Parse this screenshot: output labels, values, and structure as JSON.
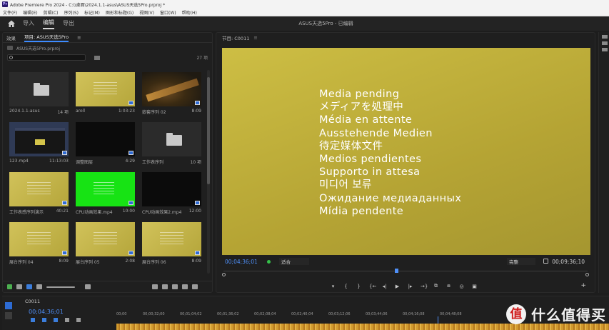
{
  "window": {
    "title": "Adobe Premiere Pro 2024 - C:\\\\桌面\\2024.1.1-asus\\ASUS天选5Pro.prproj *",
    "app_icon_text": "Pr"
  },
  "menubar": [
    "文件(F)",
    "编辑(E)",
    "剪辑(C)",
    "序列(S)",
    "标记(M)",
    "图形和标题(G)",
    "视图(V)",
    "窗口(W)",
    "帮助(H)"
  ],
  "workspace": {
    "tabs": [
      "导入",
      "编辑",
      "导出"
    ],
    "active_tab": "编辑",
    "project_name": "ASUS天选5Pro - 已编辑"
  },
  "project": {
    "tabs": [
      "效果",
      "项目: ASUS天选5Pro",
      "≡"
    ],
    "path": "ASUS天选5Pro.prproj",
    "search_placeholder": "",
    "item_count": "27 项",
    "items": [
      {
        "name": "2024.1.1-asus",
        "meta": "14 项",
        "kind": "folder"
      },
      {
        "name": "aroll",
        "meta": "1:03:23",
        "kind": "gold"
      },
      {
        "name": "嵌套序列 02",
        "meta": "8:09",
        "kind": "wood"
      },
      {
        "name": "123.mp4",
        "meta": "11:13:03",
        "kind": "screen"
      },
      {
        "name": "调整图层",
        "meta": "4:29",
        "kind": "black"
      },
      {
        "name": "工作表序列",
        "meta": "10 项",
        "kind": "folder"
      },
      {
        "name": "工作表感序列演示",
        "meta": "40:21",
        "kind": "gold"
      },
      {
        "name": "CPU动画效果.mp4",
        "meta": "10:00",
        "kind": "green"
      },
      {
        "name": "CPU动画效果2.mp4",
        "meta": "12:00",
        "kind": "black"
      },
      {
        "name": "展台序列 04",
        "meta": "8:09",
        "kind": "gold"
      },
      {
        "name": "展台序列 05",
        "meta": "2:08",
        "kind": "gold"
      },
      {
        "name": "展台序列 06",
        "meta": "8:09",
        "kind": "gold"
      }
    ]
  },
  "program": {
    "title": "节目: C0011",
    "menu_icon": "≡",
    "media_pending": [
      "Media pending",
      "メディアを処理中",
      "Média en attente",
      "Ausstehende Medien",
      "待定媒体文件",
      "Medios pendientes",
      "Supporto in attesa",
      "미디어 보류",
      "Ожидание медиаданных",
      "Mídia pendente"
    ],
    "current_tc": "00;04;36;01",
    "duration_tc": "00;09;36;10",
    "fit_label": "适合",
    "quality_label": "完整",
    "controls": [
      "▾",
      "{",
      "}",
      "{←",
      "◂|",
      "▶",
      "|▸",
      "→}",
      "⧉",
      "⧈",
      "◎",
      "▣"
    ],
    "add_button": "+"
  },
  "timeline": {
    "sequence": "C0011",
    "current_tc": "00;04;36;01",
    "ticks": [
      "00;00",
      "00;00;32;00",
      "00;01;04;02",
      "00;01;36;02",
      "00;02;08;04",
      "00;02;40;04",
      "00;03;12;06",
      "00;03;44;06",
      "00;04;16;08",
      "00;04;48;08"
    ]
  },
  "watermark": {
    "symbol": "值",
    "text": "什么值得买"
  },
  "colors": {
    "accent_blue": "#4f8ff7",
    "video_gold": "#c4b43e",
    "green_thumb": "#17e314"
  }
}
